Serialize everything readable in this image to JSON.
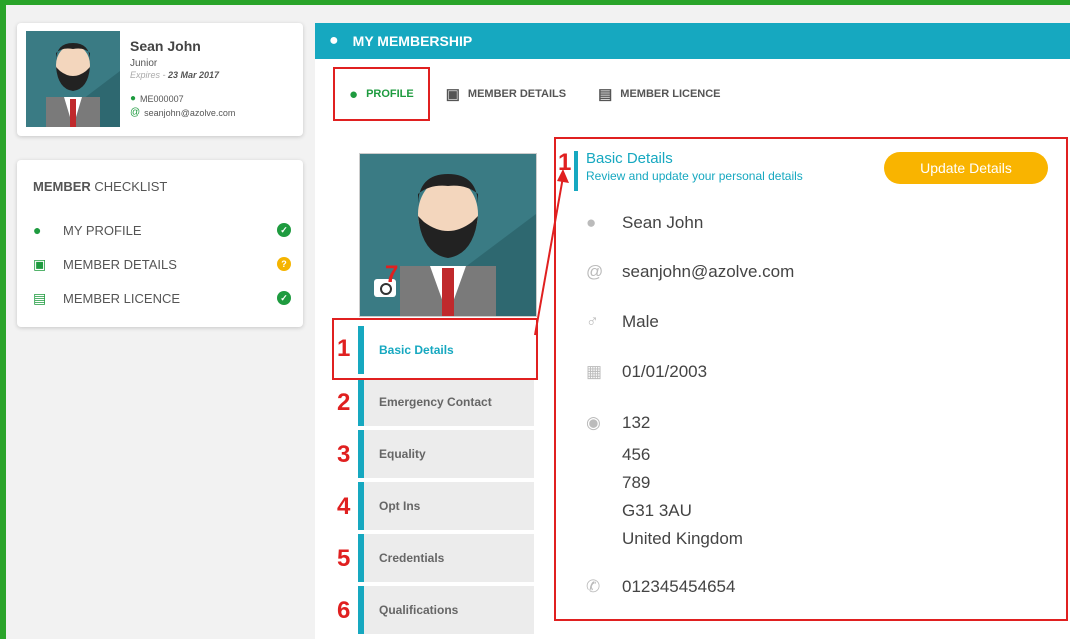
{
  "profile": {
    "name": "Sean John",
    "level": "Junior",
    "expires_label": "Expires - ",
    "expires_date": "23 Mar 2017",
    "member_id": "ME000007",
    "email": "seanjohn@azolve.com"
  },
  "checklist": {
    "title_bold": "MEMBER",
    "title_rest": " CHECKLIST",
    "items": [
      {
        "label": "MY PROFILE",
        "icon": "person-icon",
        "status": "complete"
      },
      {
        "label": "MEMBER DETAILS",
        "icon": "id-badge-icon",
        "status": "pending"
      },
      {
        "label": "MEMBER LICENCE",
        "icon": "id-card-icon",
        "status": "complete"
      }
    ]
  },
  "main": {
    "header": "MY MEMBERSHIP",
    "tabs": [
      {
        "label": "PROFILE",
        "icon": "person-icon",
        "active": true
      },
      {
        "label": "MEMBER DETAILS",
        "icon": "id-badge-icon",
        "active": false
      },
      {
        "label": "MEMBER LICENCE",
        "icon": "id-card-icon",
        "active": false
      }
    ],
    "subnav": [
      {
        "label": "Basic Details",
        "num": "1",
        "active": true
      },
      {
        "label": "Emergency Contact",
        "num": "2"
      },
      {
        "label": "Equality",
        "num": "3"
      },
      {
        "label": "Opt Ins",
        "num": "4"
      },
      {
        "label": "Credentials",
        "num": "5"
      },
      {
        "label": "Qualifications",
        "num": "6"
      }
    ],
    "photo_marker": "7"
  },
  "details": {
    "marker": "1",
    "title": "Basic Details",
    "subtitle": "Review and update your personal details",
    "update_label": "Update Details",
    "name": "Sean John",
    "email": "seanjohn@azolve.com",
    "gender": "Male",
    "dob": "01/01/2003",
    "address": [
      "132",
      "456",
      "789",
      "G31 3AU",
      "United Kingdom"
    ],
    "phone": "012345454654"
  },
  "colors": {
    "accent": "#16a8c0",
    "green": "#1e9b3f",
    "yellow": "#f9b400",
    "annotation_red": "#e02020"
  }
}
